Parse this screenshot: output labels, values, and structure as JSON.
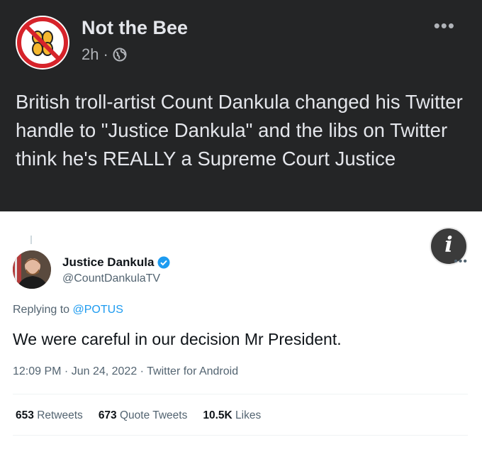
{
  "fb": {
    "page_name": "Not the Bee",
    "time": "2h",
    "separator": "·",
    "text": "British troll-artist Count Dankula changed his Twitter handle to \"Justice Dankula\" and the libs on Twitter think he's REALLY a Supreme Court Justice"
  },
  "tweet": {
    "name": "Justice Dankula",
    "handle": "@CountDankulaTV",
    "info_glyph": "i",
    "replying_prefix": "Replying to",
    "replying_to": "@POTUS",
    "text": "We were careful in our decision Mr President.",
    "timestamp": "12:09 PM · Jun 24, 2022 · Twitter for Android",
    "stats": [
      {
        "count": "653",
        "label": "Retweets"
      },
      {
        "count": "673",
        "label": "Quote Tweets"
      },
      {
        "count": "10.5K",
        "label": "Likes"
      }
    ]
  },
  "colors": {
    "fb_background": "#242526",
    "twitter_blue": "#1d9bf0",
    "logo_red": "#d6232a",
    "logo_yellow": "#f5b82e"
  }
}
